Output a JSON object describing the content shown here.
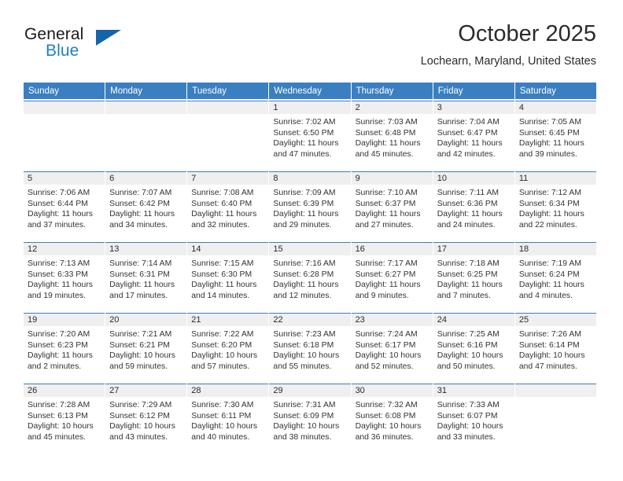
{
  "brand": {
    "name_part1": "General",
    "name_part2": "Blue",
    "accent_color": "#1f7fc4",
    "triangle_color": "#1565a8",
    "logo_icon": "triangle-sail-icon"
  },
  "header": {
    "title": "October 2025",
    "subtitle": "Lochearn, Maryland, United States"
  },
  "calendar": {
    "header_bg": "#3a7fc1",
    "weekdays": [
      "Sunday",
      "Monday",
      "Tuesday",
      "Wednesday",
      "Thursday",
      "Friday",
      "Saturday"
    ],
    "weeks": [
      [
        {
          "day": "",
          "sunrise": "",
          "sunset": "",
          "daylight_line1": "",
          "daylight_line2": "",
          "empty": true
        },
        {
          "day": "",
          "sunrise": "",
          "sunset": "",
          "daylight_line1": "",
          "daylight_line2": "",
          "empty": true
        },
        {
          "day": "",
          "sunrise": "",
          "sunset": "",
          "daylight_line1": "",
          "daylight_line2": "",
          "empty": true
        },
        {
          "day": "1",
          "sunrise": "Sunrise: 7:02 AM",
          "sunset": "Sunset: 6:50 PM",
          "daylight_line1": "Daylight: 11 hours",
          "daylight_line2": "and 47 minutes.",
          "empty": false
        },
        {
          "day": "2",
          "sunrise": "Sunrise: 7:03 AM",
          "sunset": "Sunset: 6:48 PM",
          "daylight_line1": "Daylight: 11 hours",
          "daylight_line2": "and 45 minutes.",
          "empty": false
        },
        {
          "day": "3",
          "sunrise": "Sunrise: 7:04 AM",
          "sunset": "Sunset: 6:47 PM",
          "daylight_line1": "Daylight: 11 hours",
          "daylight_line2": "and 42 minutes.",
          "empty": false
        },
        {
          "day": "4",
          "sunrise": "Sunrise: 7:05 AM",
          "sunset": "Sunset: 6:45 PM",
          "daylight_line1": "Daylight: 11 hours",
          "daylight_line2": "and 39 minutes.",
          "empty": false
        }
      ],
      [
        {
          "day": "5",
          "sunrise": "Sunrise: 7:06 AM",
          "sunset": "Sunset: 6:44 PM",
          "daylight_line1": "Daylight: 11 hours",
          "daylight_line2": "and 37 minutes.",
          "empty": false
        },
        {
          "day": "6",
          "sunrise": "Sunrise: 7:07 AM",
          "sunset": "Sunset: 6:42 PM",
          "daylight_line1": "Daylight: 11 hours",
          "daylight_line2": "and 34 minutes.",
          "empty": false
        },
        {
          "day": "7",
          "sunrise": "Sunrise: 7:08 AM",
          "sunset": "Sunset: 6:40 PM",
          "daylight_line1": "Daylight: 11 hours",
          "daylight_line2": "and 32 minutes.",
          "empty": false
        },
        {
          "day": "8",
          "sunrise": "Sunrise: 7:09 AM",
          "sunset": "Sunset: 6:39 PM",
          "daylight_line1": "Daylight: 11 hours",
          "daylight_line2": "and 29 minutes.",
          "empty": false
        },
        {
          "day": "9",
          "sunrise": "Sunrise: 7:10 AM",
          "sunset": "Sunset: 6:37 PM",
          "daylight_line1": "Daylight: 11 hours",
          "daylight_line2": "and 27 minutes.",
          "empty": false
        },
        {
          "day": "10",
          "sunrise": "Sunrise: 7:11 AM",
          "sunset": "Sunset: 6:36 PM",
          "daylight_line1": "Daylight: 11 hours",
          "daylight_line2": "and 24 minutes.",
          "empty": false
        },
        {
          "day": "11",
          "sunrise": "Sunrise: 7:12 AM",
          "sunset": "Sunset: 6:34 PM",
          "daylight_line1": "Daylight: 11 hours",
          "daylight_line2": "and 22 minutes.",
          "empty": false
        }
      ],
      [
        {
          "day": "12",
          "sunrise": "Sunrise: 7:13 AM",
          "sunset": "Sunset: 6:33 PM",
          "daylight_line1": "Daylight: 11 hours",
          "daylight_line2": "and 19 minutes.",
          "empty": false
        },
        {
          "day": "13",
          "sunrise": "Sunrise: 7:14 AM",
          "sunset": "Sunset: 6:31 PM",
          "daylight_line1": "Daylight: 11 hours",
          "daylight_line2": "and 17 minutes.",
          "empty": false
        },
        {
          "day": "14",
          "sunrise": "Sunrise: 7:15 AM",
          "sunset": "Sunset: 6:30 PM",
          "daylight_line1": "Daylight: 11 hours",
          "daylight_line2": "and 14 minutes.",
          "empty": false
        },
        {
          "day": "15",
          "sunrise": "Sunrise: 7:16 AM",
          "sunset": "Sunset: 6:28 PM",
          "daylight_line1": "Daylight: 11 hours",
          "daylight_line2": "and 12 minutes.",
          "empty": false
        },
        {
          "day": "16",
          "sunrise": "Sunrise: 7:17 AM",
          "sunset": "Sunset: 6:27 PM",
          "daylight_line1": "Daylight: 11 hours",
          "daylight_line2": "and 9 minutes.",
          "empty": false
        },
        {
          "day": "17",
          "sunrise": "Sunrise: 7:18 AM",
          "sunset": "Sunset: 6:25 PM",
          "daylight_line1": "Daylight: 11 hours",
          "daylight_line2": "and 7 minutes.",
          "empty": false
        },
        {
          "day": "18",
          "sunrise": "Sunrise: 7:19 AM",
          "sunset": "Sunset: 6:24 PM",
          "daylight_line1": "Daylight: 11 hours",
          "daylight_line2": "and 4 minutes.",
          "empty": false
        }
      ],
      [
        {
          "day": "19",
          "sunrise": "Sunrise: 7:20 AM",
          "sunset": "Sunset: 6:23 PM",
          "daylight_line1": "Daylight: 11 hours",
          "daylight_line2": "and 2 minutes.",
          "empty": false
        },
        {
          "day": "20",
          "sunrise": "Sunrise: 7:21 AM",
          "sunset": "Sunset: 6:21 PM",
          "daylight_line1": "Daylight: 10 hours",
          "daylight_line2": "and 59 minutes.",
          "empty": false
        },
        {
          "day": "21",
          "sunrise": "Sunrise: 7:22 AM",
          "sunset": "Sunset: 6:20 PM",
          "daylight_line1": "Daylight: 10 hours",
          "daylight_line2": "and 57 minutes.",
          "empty": false
        },
        {
          "day": "22",
          "sunrise": "Sunrise: 7:23 AM",
          "sunset": "Sunset: 6:18 PM",
          "daylight_line1": "Daylight: 10 hours",
          "daylight_line2": "and 55 minutes.",
          "empty": false
        },
        {
          "day": "23",
          "sunrise": "Sunrise: 7:24 AM",
          "sunset": "Sunset: 6:17 PM",
          "daylight_line1": "Daylight: 10 hours",
          "daylight_line2": "and 52 minutes.",
          "empty": false
        },
        {
          "day": "24",
          "sunrise": "Sunrise: 7:25 AM",
          "sunset": "Sunset: 6:16 PM",
          "daylight_line1": "Daylight: 10 hours",
          "daylight_line2": "and 50 minutes.",
          "empty": false
        },
        {
          "day": "25",
          "sunrise": "Sunrise: 7:26 AM",
          "sunset": "Sunset: 6:14 PM",
          "daylight_line1": "Daylight: 10 hours",
          "daylight_line2": "and 47 minutes.",
          "empty": false
        }
      ],
      [
        {
          "day": "26",
          "sunrise": "Sunrise: 7:28 AM",
          "sunset": "Sunset: 6:13 PM",
          "daylight_line1": "Daylight: 10 hours",
          "daylight_line2": "and 45 minutes.",
          "empty": false
        },
        {
          "day": "27",
          "sunrise": "Sunrise: 7:29 AM",
          "sunset": "Sunset: 6:12 PM",
          "daylight_line1": "Daylight: 10 hours",
          "daylight_line2": "and 43 minutes.",
          "empty": false
        },
        {
          "day": "28",
          "sunrise": "Sunrise: 7:30 AM",
          "sunset": "Sunset: 6:11 PM",
          "daylight_line1": "Daylight: 10 hours",
          "daylight_line2": "and 40 minutes.",
          "empty": false
        },
        {
          "day": "29",
          "sunrise": "Sunrise: 7:31 AM",
          "sunset": "Sunset: 6:09 PM",
          "daylight_line1": "Daylight: 10 hours",
          "daylight_line2": "and 38 minutes.",
          "empty": false
        },
        {
          "day": "30",
          "sunrise": "Sunrise: 7:32 AM",
          "sunset": "Sunset: 6:08 PM",
          "daylight_line1": "Daylight: 10 hours",
          "daylight_line2": "and 36 minutes.",
          "empty": false
        },
        {
          "day": "31",
          "sunrise": "Sunrise: 7:33 AM",
          "sunset": "Sunset: 6:07 PM",
          "daylight_line1": "Daylight: 10 hours",
          "daylight_line2": "and 33 minutes.",
          "empty": false
        },
        {
          "day": "",
          "sunrise": "",
          "sunset": "",
          "daylight_line1": "",
          "daylight_line2": "",
          "empty": true
        }
      ]
    ]
  }
}
